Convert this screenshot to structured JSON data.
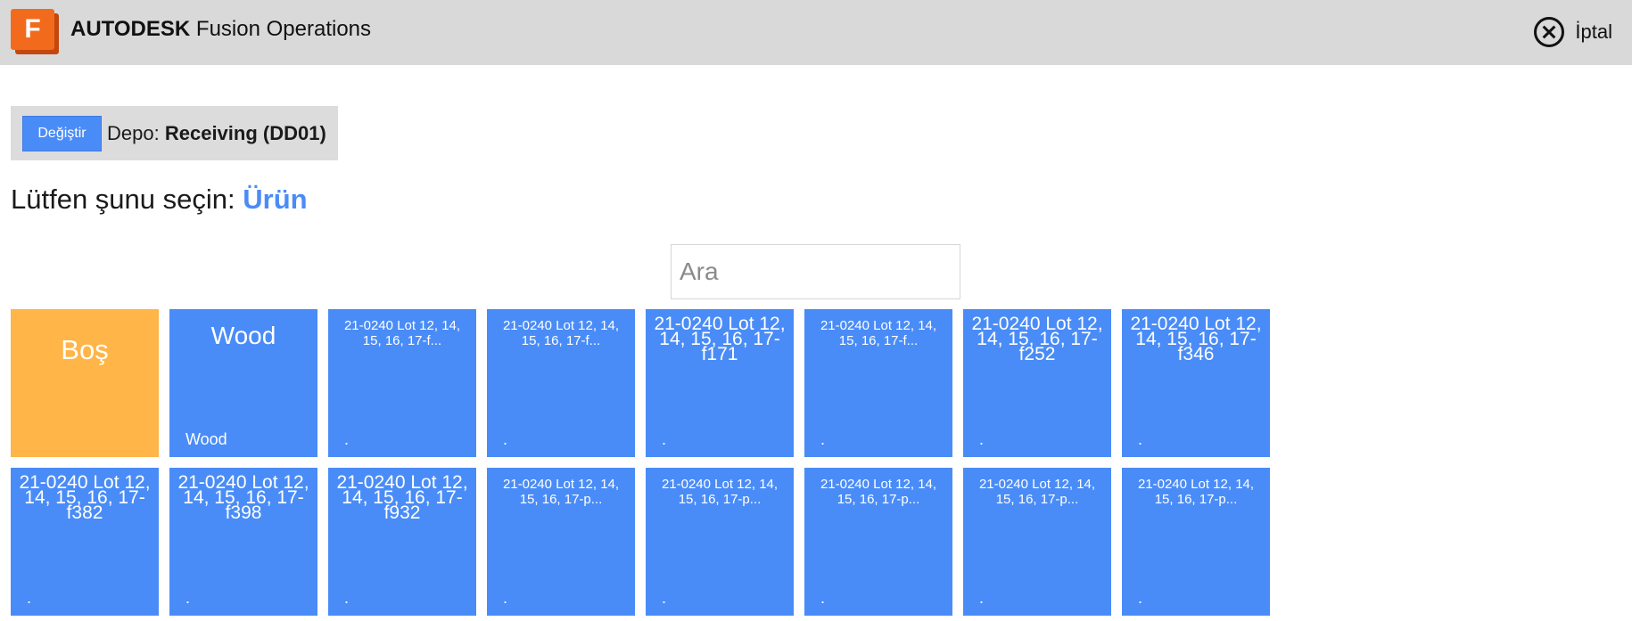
{
  "header": {
    "logo_letter": "F",
    "brand_bold": "AUTODESK",
    "brand_rest": "Fusion Operations",
    "cancel_label": "İptal"
  },
  "depot": {
    "change_label": "Değiştir",
    "prefix": "Depo:",
    "value": "Receiving (DD01)"
  },
  "prompt": {
    "text": "Lütfen şunu seçin:",
    "highlight": "Ürün"
  },
  "search": {
    "placeholder": "Ara",
    "value": ""
  },
  "tiles": [
    {
      "title": "Boş",
      "sub": ""
    },
    {
      "title": "Wood",
      "sub": "Wood"
    },
    {
      "title": "21-0240 Lot 12, 14, 15, 16, 17-f...",
      "sub": "."
    },
    {
      "title": "21-0240 Lot 12, 14, 15, 16, 17-f...",
      "sub": "."
    },
    {
      "title": "21-0240 Lot 12, 14, 15, 16, 17-f171",
      "sub": "."
    },
    {
      "title": "21-0240 Lot 12, 14, 15, 16, 17-f...",
      "sub": "."
    },
    {
      "title": "21-0240 Lot 12, 14, 15, 16, 17-f252",
      "sub": "."
    },
    {
      "title": "21-0240 Lot 12, 14, 15, 16, 17-f346",
      "sub": "."
    },
    {
      "title": "21-0240 Lot 12, 14, 15, 16, 17-f382",
      "sub": "."
    },
    {
      "title": "21-0240 Lot 12, 14, 15, 16, 17-f398",
      "sub": "."
    },
    {
      "title": "21-0240 Lot 12, 14, 15, 16, 17-f932",
      "sub": "."
    },
    {
      "title": "21-0240 Lot 12, 14, 15, 16, 17-p...",
      "sub": "."
    },
    {
      "title": "21-0240 Lot 12, 14, 15, 16, 17-p...",
      "sub": "."
    },
    {
      "title": "21-0240 Lot 12, 14, 15, 16, 17-p...",
      "sub": "."
    },
    {
      "title": "21-0240 Lot 12, 14, 15, 16, 17-p...",
      "sub": "."
    },
    {
      "title": "21-0240 Lot 12, 14, 15, 16, 17-p...",
      "sub": "."
    }
  ],
  "colors": {
    "accent": "#4a8cf7",
    "empty_tile": "#ffb547",
    "header_bg": "#d9d9d9",
    "logo": "#f26b1d"
  }
}
